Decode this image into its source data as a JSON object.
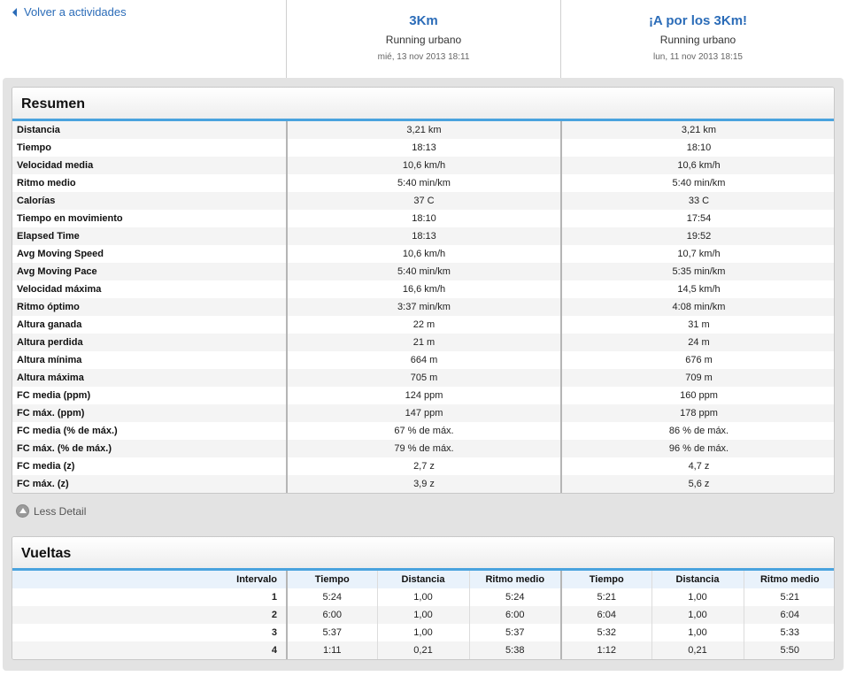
{
  "nav": {
    "back_label": "Volver a actividades"
  },
  "activities": [
    {
      "title": "3Km",
      "type": "Running urbano",
      "date": "mié, 13 nov 2013 18:11"
    },
    {
      "title": "¡A por los 3Km!",
      "type": "Running urbano",
      "date": "lun, 11 nov 2013 18:15"
    }
  ],
  "summary": {
    "title": "Resumen",
    "rows": [
      {
        "label": "Distancia",
        "a": "3,21 km",
        "b": "3,21 km"
      },
      {
        "label": "Tiempo",
        "a": "18:13",
        "b": "18:10"
      },
      {
        "label": "Velocidad media",
        "a": "10,6 km/h",
        "b": "10,6 km/h"
      },
      {
        "label": "Ritmo medio",
        "a": "5:40 min/km",
        "b": "5:40 min/km"
      },
      {
        "label": "Calorías",
        "a": "37 C",
        "b": "33 C"
      },
      {
        "label": "Tiempo en movimiento",
        "a": "18:10",
        "b": "17:54"
      },
      {
        "label": "Elapsed Time",
        "a": "18:13",
        "b": "19:52"
      },
      {
        "label": "Avg Moving Speed",
        "a": "10,6 km/h",
        "b": "10,7 km/h"
      },
      {
        "label": "Avg Moving Pace",
        "a": "5:40 min/km",
        "b": "5:35 min/km"
      },
      {
        "label": "Velocidad máxima",
        "a": "16,6 km/h",
        "b": "14,5 km/h"
      },
      {
        "label": "Ritmo óptimo",
        "a": "3:37 min/km",
        "b": "4:08 min/km"
      },
      {
        "label": "Altura ganada",
        "a": "22 m",
        "b": "31 m"
      },
      {
        "label": "Altura perdida",
        "a": "21 m",
        "b": "24 m"
      },
      {
        "label": "Altura mínima",
        "a": "664 m",
        "b": "676 m"
      },
      {
        "label": "Altura máxima",
        "a": "705 m",
        "b": "709 m"
      },
      {
        "label": "FC media (ppm)",
        "a": "124 ppm",
        "b": "160 ppm"
      },
      {
        "label": "FC máx. (ppm)",
        "a": "147 ppm",
        "b": "178 ppm"
      },
      {
        "label": "FC media (% de máx.)",
        "a": "67 % de máx.",
        "b": "86 % de máx."
      },
      {
        "label": "FC máx. (% de máx.)",
        "a": "79 % de máx.",
        "b": "96 % de máx."
      },
      {
        "label": "FC media (z)",
        "a": "2,7 z",
        "b": "4,7 z"
      },
      {
        "label": "FC máx. (z)",
        "a": "3,9 z",
        "b": "5,6 z"
      }
    ]
  },
  "less_detail": {
    "label": "Less Detail"
  },
  "laps": {
    "title": "Vueltas",
    "headers": [
      "Intervalo",
      "Tiempo",
      "Distancia",
      "Ritmo medio",
      "Tiempo",
      "Distancia",
      "Ritmo medio"
    ],
    "rows": [
      [
        "1",
        "5:24",
        "1,00",
        "5:24",
        "5:21",
        "1,00",
        "5:21"
      ],
      [
        "2",
        "6:00",
        "1,00",
        "6:00",
        "6:04",
        "1,00",
        "6:04"
      ],
      [
        "3",
        "5:37",
        "1,00",
        "5:37",
        "5:32",
        "1,00",
        "5:33"
      ],
      [
        "4",
        "1:11",
        "0,21",
        "5:38",
        "1:12",
        "0,21",
        "5:50"
      ]
    ]
  }
}
